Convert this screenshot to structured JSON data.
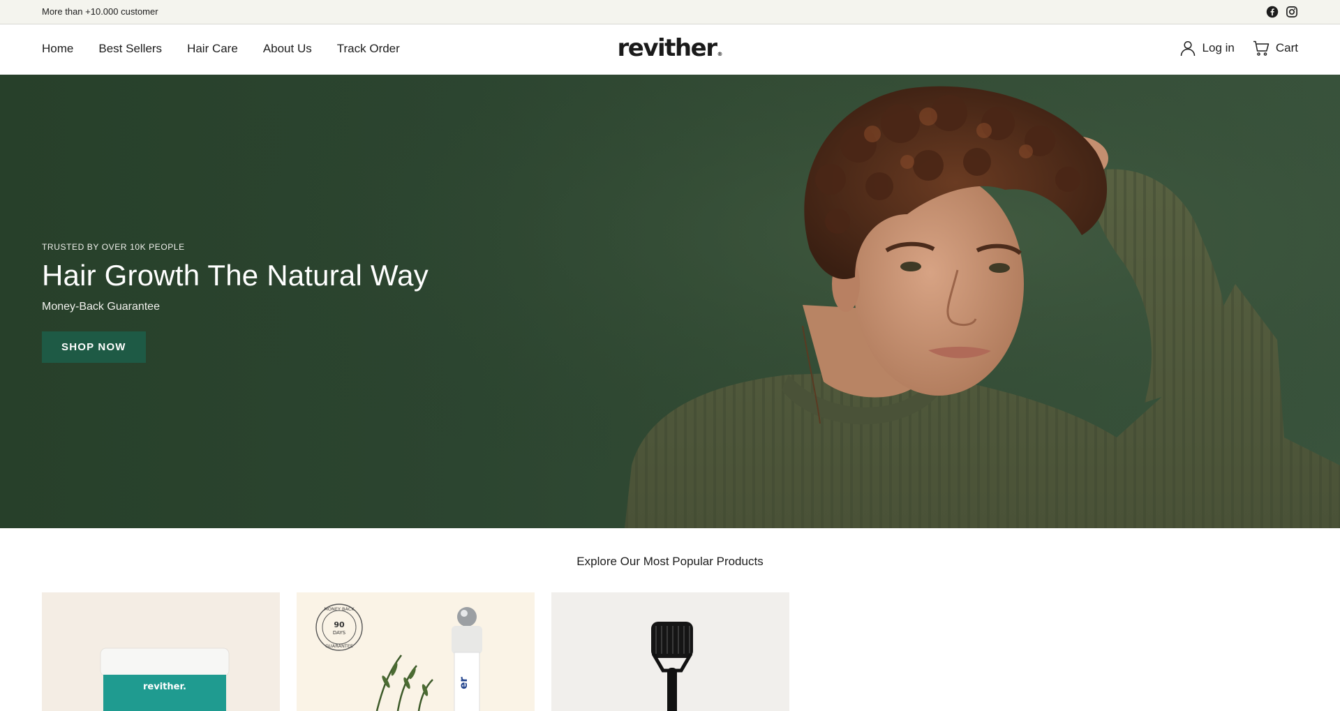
{
  "announcement": {
    "text": "More than +10.000 customer",
    "social": [
      {
        "name": "facebook-icon"
      },
      {
        "name": "instagram-icon"
      }
    ]
  },
  "header": {
    "nav": [
      {
        "label": "Home"
      },
      {
        "label": "Best Sellers"
      },
      {
        "label": "Hair Care"
      },
      {
        "label": "About Us"
      },
      {
        "label": "Track Order"
      }
    ],
    "logo": "revither",
    "logo_mark": "®",
    "login_label": "Log in",
    "cart_label": "Cart"
  },
  "hero": {
    "eyebrow": "TRUSTED BY OVER 10K PEOPLE",
    "title": "Hair Growth The Natural Way",
    "subtitle": "Money-Back Guarantee",
    "cta_label": "SHOP NOW",
    "accent_color": "#1e5a45",
    "background_color": "#2e4731"
  },
  "products": {
    "section_title": "Explore Our Most Popular Products",
    "cards": [
      {
        "jar_label": "revither."
      },
      {
        "badge_top": "MONEY BACK",
        "badge_number": "90",
        "badge_unit": "DAYS",
        "badge_bottom": "GUARANTEE",
        "bottle_label": "er"
      },
      {}
    ]
  }
}
